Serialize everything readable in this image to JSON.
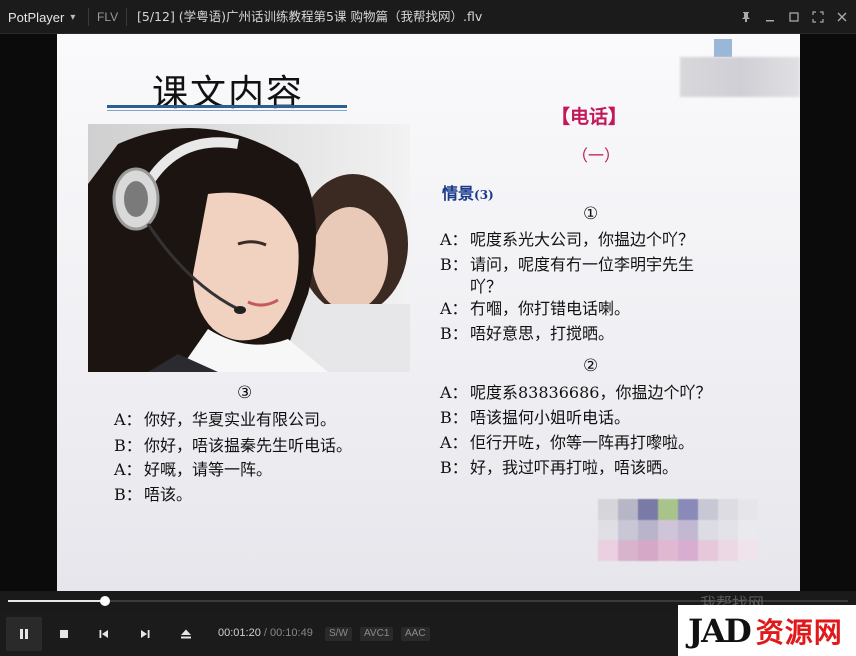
{
  "app": {
    "name": "PotPlayer",
    "format": "FLV",
    "title": "[5/12] (学粤语)广州话训练教程第5课 购物篇（我帮找网）.flv"
  },
  "slide": {
    "heading": "课文内容",
    "section": "【电话】",
    "section_sub": "（一）",
    "scene_label": "情景",
    "scene_num": "(3)",
    "block1": {
      "num": "①",
      "lines": [
        {
          "who": "A：",
          "text": "呢度系光大公司，你揾边个吖？"
        },
        {
          "who": "B：",
          "text": "请问，呢度有冇一位李明宇先生",
          "cont": "吖？"
        },
        {
          "who": "A：",
          "text": "冇嗰，你打错电话喇。"
        },
        {
          "who": "B：",
          "text": "唔好意思，打搅晒。"
        }
      ]
    },
    "block2": {
      "num": "②",
      "lines": [
        {
          "who": "A：",
          "text": "呢度系83836686，你揾边个吖？"
        },
        {
          "who": "B：",
          "text": "唔该揾何小姐听电话。"
        },
        {
          "who": "A：",
          "text": "佢行开咗，你等一阵再打嚟啦。"
        },
        {
          "who": "B：",
          "text": "好，我过吓再打啦，唔该晒。"
        }
      ]
    },
    "block3": {
      "num": "③",
      "lines": [
        {
          "who": "A：",
          "text": "你好，华夏实业有限公司。"
        },
        {
          "who": "B：",
          "text": "你好，唔该揾秦先生听电话。"
        },
        {
          "who": "A：",
          "text": "好嘅，请等一阵。"
        },
        {
          "who": "B：",
          "text": "唔该。"
        }
      ]
    }
  },
  "player": {
    "progress": 0.115,
    "current_time": "00:01:20",
    "total_time": "00:10:49",
    "separator": "/",
    "badges": [
      "S/W",
      "AVC1",
      "AAC"
    ]
  },
  "watermark": {
    "logo": "JAD",
    "text": "资源网",
    "ghost": "我帮找网"
  },
  "colors": {
    "accent": "#c2185b",
    "scene": "#1a3a8a",
    "underline": "#2d5f8f"
  }
}
